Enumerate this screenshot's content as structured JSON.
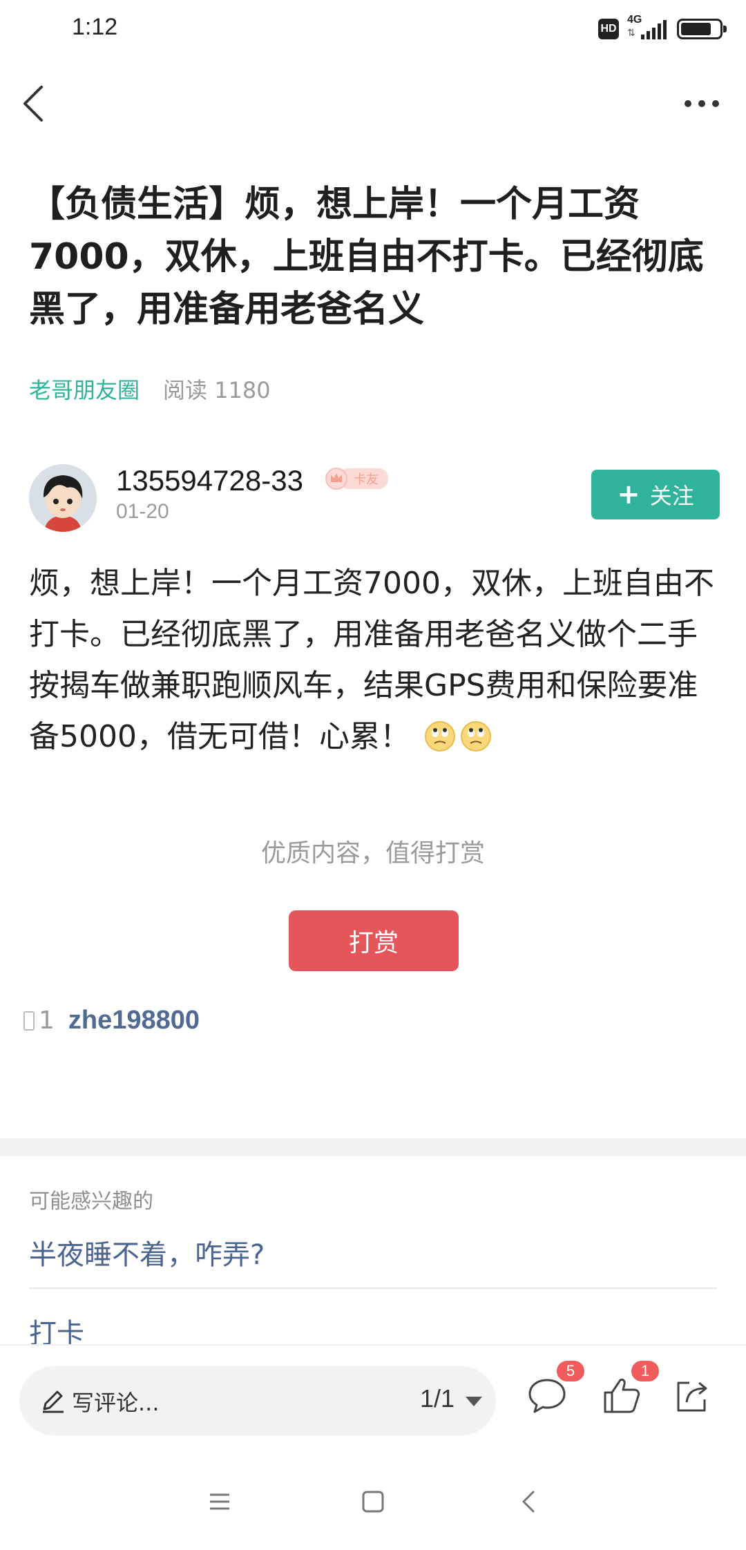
{
  "status_bar": {
    "time": "1:12",
    "hd": "HD",
    "network": "4G"
  },
  "post": {
    "title": "【负债生活】烦，想上岸！一个月工资7000，双休，上班自由不打卡。已经彻底黑了，用准备用老爸名义",
    "group": "老哥朋友圈",
    "reads": "阅读 1180"
  },
  "author": {
    "name": "135594728-33",
    "badge": "卡友",
    "date": "01-20",
    "follow_label": "关注"
  },
  "content": {
    "body": "烦，想上岸！一个月工资7000，双休，上班自由不打卡。已经彻底黑了，用准备用老爸名义做个二手按揭车做兼职跑顺风车，结果GPS费用和保险要准备5000，借无可借！心累！"
  },
  "reward": {
    "hint": "优质内容，值得打赏",
    "button_label": "打赏",
    "count": "1",
    "rewarder": "zhe198800"
  },
  "related": {
    "title": "可能感兴趣的",
    "items": [
      {
        "label": "半夜睡不着，咋弄?"
      },
      {
        "label": "打卡"
      }
    ]
  },
  "bottom_bar": {
    "comment_placeholder": "写评论...",
    "page_indicator": "1/1",
    "comment_count": "5",
    "like_count": "1"
  },
  "colors": {
    "accent_green": "#2fb39b",
    "reward_red": "#e5565b",
    "link_blue": "#4a6391",
    "badge_red": "#f05b5b"
  }
}
